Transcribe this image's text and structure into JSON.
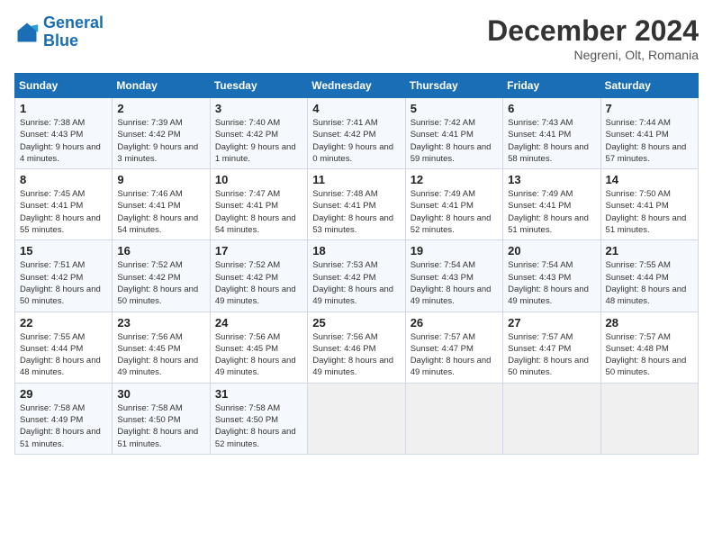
{
  "header": {
    "logo_line1": "General",
    "logo_line2": "Blue",
    "month": "December 2024",
    "location": "Negreni, Olt, Romania"
  },
  "weekdays": [
    "Sunday",
    "Monday",
    "Tuesday",
    "Wednesday",
    "Thursday",
    "Friday",
    "Saturday"
  ],
  "weeks": [
    [
      {
        "day": "1",
        "rise": "7:38 AM",
        "set": "4:43 PM",
        "daylight": "9 hours and 4 minutes."
      },
      {
        "day": "2",
        "rise": "7:39 AM",
        "set": "4:42 PM",
        "daylight": "9 hours and 3 minutes."
      },
      {
        "day": "3",
        "rise": "7:40 AM",
        "set": "4:42 PM",
        "daylight": "9 hours and 1 minute."
      },
      {
        "day": "4",
        "rise": "7:41 AM",
        "set": "4:42 PM",
        "daylight": "9 hours and 0 minutes."
      },
      {
        "day": "5",
        "rise": "7:42 AM",
        "set": "4:41 PM",
        "daylight": "8 hours and 59 minutes."
      },
      {
        "day": "6",
        "rise": "7:43 AM",
        "set": "4:41 PM",
        "daylight": "8 hours and 58 minutes."
      },
      {
        "day": "7",
        "rise": "7:44 AM",
        "set": "4:41 PM",
        "daylight": "8 hours and 57 minutes."
      }
    ],
    [
      {
        "day": "8",
        "rise": "7:45 AM",
        "set": "4:41 PM",
        "daylight": "8 hours and 55 minutes."
      },
      {
        "day": "9",
        "rise": "7:46 AM",
        "set": "4:41 PM",
        "daylight": "8 hours and 54 minutes."
      },
      {
        "day": "10",
        "rise": "7:47 AM",
        "set": "4:41 PM",
        "daylight": "8 hours and 54 minutes."
      },
      {
        "day": "11",
        "rise": "7:48 AM",
        "set": "4:41 PM",
        "daylight": "8 hours and 53 minutes."
      },
      {
        "day": "12",
        "rise": "7:49 AM",
        "set": "4:41 PM",
        "daylight": "8 hours and 52 minutes."
      },
      {
        "day": "13",
        "rise": "7:49 AM",
        "set": "4:41 PM",
        "daylight": "8 hours and 51 minutes."
      },
      {
        "day": "14",
        "rise": "7:50 AM",
        "set": "4:41 PM",
        "daylight": "8 hours and 51 minutes."
      }
    ],
    [
      {
        "day": "15",
        "rise": "7:51 AM",
        "set": "4:42 PM",
        "daylight": "8 hours and 50 minutes."
      },
      {
        "day": "16",
        "rise": "7:52 AM",
        "set": "4:42 PM",
        "daylight": "8 hours and 50 minutes."
      },
      {
        "day": "17",
        "rise": "7:52 AM",
        "set": "4:42 PM",
        "daylight": "8 hours and 49 minutes."
      },
      {
        "day": "18",
        "rise": "7:53 AM",
        "set": "4:42 PM",
        "daylight": "8 hours and 49 minutes."
      },
      {
        "day": "19",
        "rise": "7:54 AM",
        "set": "4:43 PM",
        "daylight": "8 hours and 49 minutes."
      },
      {
        "day": "20",
        "rise": "7:54 AM",
        "set": "4:43 PM",
        "daylight": "8 hours and 49 minutes."
      },
      {
        "day": "21",
        "rise": "7:55 AM",
        "set": "4:44 PM",
        "daylight": "8 hours and 48 minutes."
      }
    ],
    [
      {
        "day": "22",
        "rise": "7:55 AM",
        "set": "4:44 PM",
        "daylight": "8 hours and 48 minutes."
      },
      {
        "day": "23",
        "rise": "7:56 AM",
        "set": "4:45 PM",
        "daylight": "8 hours and 49 minutes."
      },
      {
        "day": "24",
        "rise": "7:56 AM",
        "set": "4:45 PM",
        "daylight": "8 hours and 49 minutes."
      },
      {
        "day": "25",
        "rise": "7:56 AM",
        "set": "4:46 PM",
        "daylight": "8 hours and 49 minutes."
      },
      {
        "day": "26",
        "rise": "7:57 AM",
        "set": "4:47 PM",
        "daylight": "8 hours and 49 minutes."
      },
      {
        "day": "27",
        "rise": "7:57 AM",
        "set": "4:47 PM",
        "daylight": "8 hours and 50 minutes."
      },
      {
        "day": "28",
        "rise": "7:57 AM",
        "set": "4:48 PM",
        "daylight": "8 hours and 50 minutes."
      }
    ],
    [
      {
        "day": "29",
        "rise": "7:58 AM",
        "set": "4:49 PM",
        "daylight": "8 hours and 51 minutes."
      },
      {
        "day": "30",
        "rise": "7:58 AM",
        "set": "4:50 PM",
        "daylight": "8 hours and 51 minutes."
      },
      {
        "day": "31",
        "rise": "7:58 AM",
        "set": "4:50 PM",
        "daylight": "8 hours and 52 minutes."
      },
      null,
      null,
      null,
      null
    ]
  ]
}
